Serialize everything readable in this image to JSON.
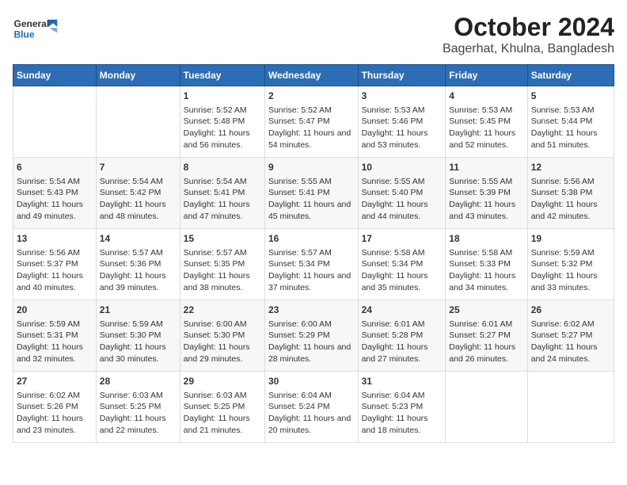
{
  "logo": {
    "text_general": "General",
    "text_blue": "Blue"
  },
  "title": "October 2024",
  "subtitle": "Bagerhat, Khulna, Bangladesh",
  "days_of_week": [
    "Sunday",
    "Monday",
    "Tuesday",
    "Wednesday",
    "Thursday",
    "Friday",
    "Saturday"
  ],
  "weeks": [
    [
      {
        "day": "",
        "content": ""
      },
      {
        "day": "",
        "content": ""
      },
      {
        "day": "1",
        "sunrise": "Sunrise: 5:52 AM",
        "sunset": "Sunset: 5:48 PM",
        "daylight": "Daylight: 11 hours and 56 minutes."
      },
      {
        "day": "2",
        "sunrise": "Sunrise: 5:52 AM",
        "sunset": "Sunset: 5:47 PM",
        "daylight": "Daylight: 11 hours and 54 minutes."
      },
      {
        "day": "3",
        "sunrise": "Sunrise: 5:53 AM",
        "sunset": "Sunset: 5:46 PM",
        "daylight": "Daylight: 11 hours and 53 minutes."
      },
      {
        "day": "4",
        "sunrise": "Sunrise: 5:53 AM",
        "sunset": "Sunset: 5:45 PM",
        "daylight": "Daylight: 11 hours and 52 minutes."
      },
      {
        "day": "5",
        "sunrise": "Sunrise: 5:53 AM",
        "sunset": "Sunset: 5:44 PM",
        "daylight": "Daylight: 11 hours and 51 minutes."
      }
    ],
    [
      {
        "day": "6",
        "sunrise": "Sunrise: 5:54 AM",
        "sunset": "Sunset: 5:43 PM",
        "daylight": "Daylight: 11 hours and 49 minutes."
      },
      {
        "day": "7",
        "sunrise": "Sunrise: 5:54 AM",
        "sunset": "Sunset: 5:42 PM",
        "daylight": "Daylight: 11 hours and 48 minutes."
      },
      {
        "day": "8",
        "sunrise": "Sunrise: 5:54 AM",
        "sunset": "Sunset: 5:41 PM",
        "daylight": "Daylight: 11 hours and 47 minutes."
      },
      {
        "day": "9",
        "sunrise": "Sunrise: 5:55 AM",
        "sunset": "Sunset: 5:41 PM",
        "daylight": "Daylight: 11 hours and 45 minutes."
      },
      {
        "day": "10",
        "sunrise": "Sunrise: 5:55 AM",
        "sunset": "Sunset: 5:40 PM",
        "daylight": "Daylight: 11 hours and 44 minutes."
      },
      {
        "day": "11",
        "sunrise": "Sunrise: 5:55 AM",
        "sunset": "Sunset: 5:39 PM",
        "daylight": "Daylight: 11 hours and 43 minutes."
      },
      {
        "day": "12",
        "sunrise": "Sunrise: 5:56 AM",
        "sunset": "Sunset: 5:38 PM",
        "daylight": "Daylight: 11 hours and 42 minutes."
      }
    ],
    [
      {
        "day": "13",
        "sunrise": "Sunrise: 5:56 AM",
        "sunset": "Sunset: 5:37 PM",
        "daylight": "Daylight: 11 hours and 40 minutes."
      },
      {
        "day": "14",
        "sunrise": "Sunrise: 5:57 AM",
        "sunset": "Sunset: 5:36 PM",
        "daylight": "Daylight: 11 hours and 39 minutes."
      },
      {
        "day": "15",
        "sunrise": "Sunrise: 5:57 AM",
        "sunset": "Sunset: 5:35 PM",
        "daylight": "Daylight: 11 hours and 38 minutes."
      },
      {
        "day": "16",
        "sunrise": "Sunrise: 5:57 AM",
        "sunset": "Sunset: 5:34 PM",
        "daylight": "Daylight: 11 hours and 37 minutes."
      },
      {
        "day": "17",
        "sunrise": "Sunrise: 5:58 AM",
        "sunset": "Sunset: 5:34 PM",
        "daylight": "Daylight: 11 hours and 35 minutes."
      },
      {
        "day": "18",
        "sunrise": "Sunrise: 5:58 AM",
        "sunset": "Sunset: 5:33 PM",
        "daylight": "Daylight: 11 hours and 34 minutes."
      },
      {
        "day": "19",
        "sunrise": "Sunrise: 5:59 AM",
        "sunset": "Sunset: 5:32 PM",
        "daylight": "Daylight: 11 hours and 33 minutes."
      }
    ],
    [
      {
        "day": "20",
        "sunrise": "Sunrise: 5:59 AM",
        "sunset": "Sunset: 5:31 PM",
        "daylight": "Daylight: 11 hours and 32 minutes."
      },
      {
        "day": "21",
        "sunrise": "Sunrise: 5:59 AM",
        "sunset": "Sunset: 5:30 PM",
        "daylight": "Daylight: 11 hours and 30 minutes."
      },
      {
        "day": "22",
        "sunrise": "Sunrise: 6:00 AM",
        "sunset": "Sunset: 5:30 PM",
        "daylight": "Daylight: 11 hours and 29 minutes."
      },
      {
        "day": "23",
        "sunrise": "Sunrise: 6:00 AM",
        "sunset": "Sunset: 5:29 PM",
        "daylight": "Daylight: 11 hours and 28 minutes."
      },
      {
        "day": "24",
        "sunrise": "Sunrise: 6:01 AM",
        "sunset": "Sunset: 5:28 PM",
        "daylight": "Daylight: 11 hours and 27 minutes."
      },
      {
        "day": "25",
        "sunrise": "Sunrise: 6:01 AM",
        "sunset": "Sunset: 5:27 PM",
        "daylight": "Daylight: 11 hours and 26 minutes."
      },
      {
        "day": "26",
        "sunrise": "Sunrise: 6:02 AM",
        "sunset": "Sunset: 5:27 PM",
        "daylight": "Daylight: 11 hours and 24 minutes."
      }
    ],
    [
      {
        "day": "27",
        "sunrise": "Sunrise: 6:02 AM",
        "sunset": "Sunset: 5:26 PM",
        "daylight": "Daylight: 11 hours and 23 minutes."
      },
      {
        "day": "28",
        "sunrise": "Sunrise: 6:03 AM",
        "sunset": "Sunset: 5:25 PM",
        "daylight": "Daylight: 11 hours and 22 minutes."
      },
      {
        "day": "29",
        "sunrise": "Sunrise: 6:03 AM",
        "sunset": "Sunset: 5:25 PM",
        "daylight": "Daylight: 11 hours and 21 minutes."
      },
      {
        "day": "30",
        "sunrise": "Sunrise: 6:04 AM",
        "sunset": "Sunset: 5:24 PM",
        "daylight": "Daylight: 11 hours and 20 minutes."
      },
      {
        "day": "31",
        "sunrise": "Sunrise: 6:04 AM",
        "sunset": "Sunset: 5:23 PM",
        "daylight": "Daylight: 11 hours and 18 minutes."
      },
      {
        "day": "",
        "content": ""
      },
      {
        "day": "",
        "content": ""
      }
    ]
  ]
}
